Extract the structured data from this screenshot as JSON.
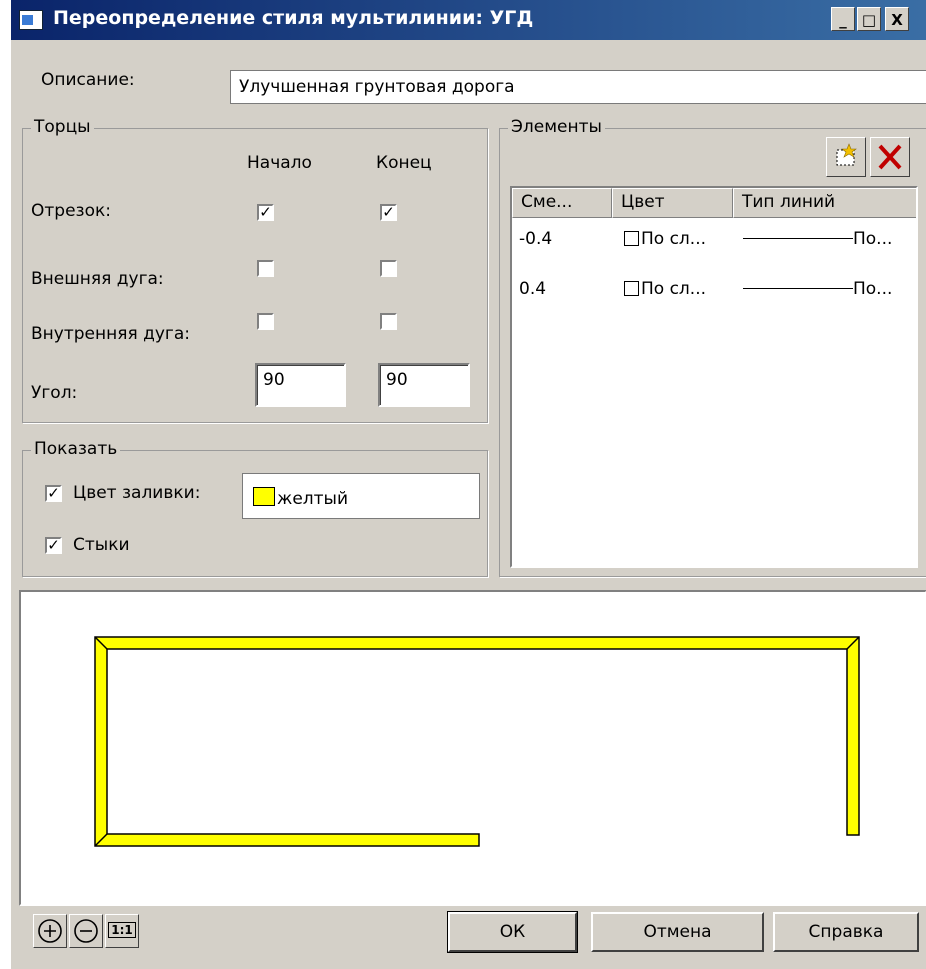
{
  "window": {
    "title": "Переопределение стиля мультилинии: УГД",
    "min_glyph": "_",
    "max_glyph": "□",
    "close_glyph": "X"
  },
  "description": {
    "label": "Описание:",
    "value": "Улучшенная грунтовая дорога"
  },
  "caps": {
    "title": "Торцы",
    "col_start": "Начало",
    "col_end": "Конец",
    "rows": [
      {
        "label": "Отрезок:",
        "start": true,
        "end": true
      },
      {
        "label": "Внешняя дуга:",
        "start": false,
        "end": false
      },
      {
        "label": "Внутренняя дуга:",
        "start": false,
        "end": false
      }
    ],
    "angle_label": "Угол:",
    "angle_start": "90",
    "angle_end": "90"
  },
  "show": {
    "title": "Показать",
    "fill_label": "Цвет заливки:",
    "fill_checked": true,
    "fill_color_name": "желтый",
    "fill_color": "#ffff00",
    "joints_label": "Стыки",
    "joints_checked": true
  },
  "elements": {
    "title": "Элементы",
    "headers": [
      "Сме...",
      "Цвет",
      "Тип линий"
    ],
    "rows": [
      {
        "offset": "-0.4",
        "color": "По сл...",
        "linetype": "По..."
      },
      {
        "offset": "0.4",
        "color": "По сл...",
        "linetype": "По..."
      }
    ]
  },
  "buttons": {
    "ok": "ОК",
    "cancel": "Отмена",
    "help": "Справка",
    "zoom_reset": "1:1"
  },
  "icons": {
    "add_element": "new-element-icon",
    "delete_element": "delete-x-icon",
    "zoom_in": "zoom-in-icon",
    "zoom_out": "zoom-out-icon"
  }
}
